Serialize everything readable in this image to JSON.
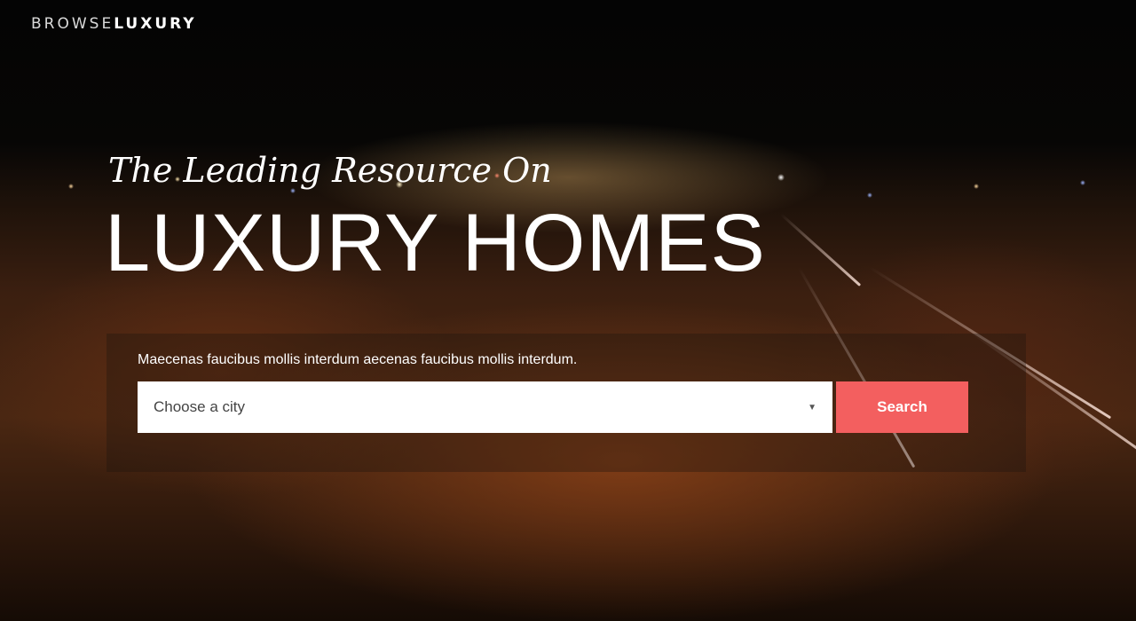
{
  "brand": {
    "part1": "BROWSE",
    "part2": "LUXURY"
  },
  "hero": {
    "tagline": "The Leading Resource On",
    "headline": "LUXURY HOMES",
    "subtext": "Maecenas faucibus mollis interdum aecenas faucibus mollis interdum."
  },
  "search": {
    "city_select": {
      "value": "Choose a city",
      "icon": "chevron-down-icon"
    },
    "button_label": "Search"
  },
  "colors": {
    "accent": "#f35f5f",
    "text": "#ffffff"
  }
}
